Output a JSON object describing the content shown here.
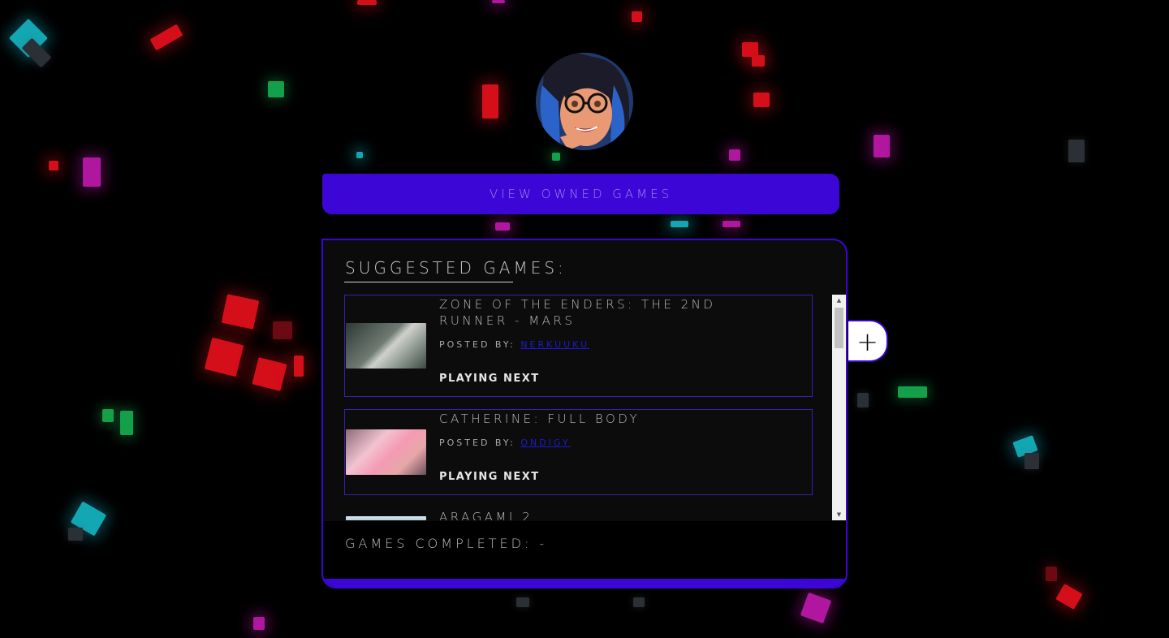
{
  "header": {
    "owned_button_label": "VIEW OWNED GAMES"
  },
  "panel": {
    "title": "SUGGESTED GAMES:",
    "games": [
      {
        "title_line1": "ZONE OF THE ENDERS: THE 2ND",
        "title_line2": "RUNNER - MARS",
        "posted_label": "POSTED BY:",
        "posted_user": "NERKUUKU",
        "action": "PLAYING NEXT"
      },
      {
        "title_line1": "CATHERINE: FULL BODY",
        "posted_label": "POSTED BY:",
        "posted_user": "ONDIGY",
        "action": "PLAYING NEXT"
      },
      {
        "title_line1": "ARAGAMI 2"
      }
    ],
    "completed_label": "GAMES COMPLETED: -"
  },
  "add_button_label": "+",
  "scrollbar": {
    "up_arrow": "▲",
    "down_arrow": "▼"
  },
  "theme": {
    "accent": "#3b06d6",
    "link": "#1d1bd0"
  }
}
